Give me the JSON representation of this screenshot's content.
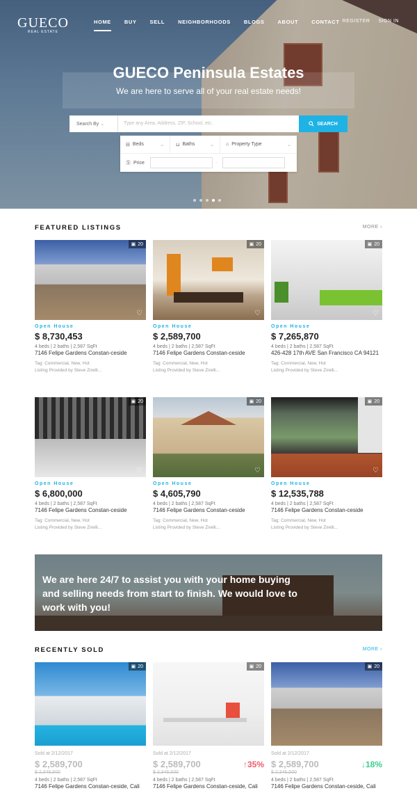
{
  "header": {
    "logo_title": "GUECO",
    "logo_sub": "REAL ESTATE",
    "nav": [
      "HOME",
      "BUY",
      "SELL",
      "NEIGHBORHOODS",
      "BLOGS",
      "ABOUT",
      "CONTACT"
    ],
    "register": "REGISTER",
    "signin": "SIGN IN"
  },
  "hero": {
    "title": "GUECO Peninsula Estates",
    "subtitle": "We are here to serve all of your real estate needs!"
  },
  "search": {
    "by": "Search By",
    "placeholder": "Type any Area, Address, ZIP, School, etc.",
    "button": "SEARCH"
  },
  "filters": {
    "beds": "Beds",
    "baths": "Baths",
    "type": "Property Type",
    "price": "Price"
  },
  "featured": {
    "title": "FEATURED LISTINGS",
    "more": "MORE",
    "photo_count": "20",
    "listings": [
      {
        "status": "Open House",
        "price": "$ 8,730,453",
        "meta": "4 beds  |  2 baths  |  2,587 SqFt",
        "address": "7146 Felipe Gardens Constan-ceside",
        "tags": "Tag: Commercial, New, Hot",
        "provider": "Listing Provided by Steve Zirelli..."
      },
      {
        "status": "Open House",
        "price": "$ 2,589,700",
        "meta": "4 beds  |  2 baths  |  2,587 SqFt",
        "address": "7146 Felipe Gardens Constan-ceside",
        "tags": "Tag: Commercial, New, Hot",
        "provider": "Listing Provided by Steve Zirelli..."
      },
      {
        "status": "Open House",
        "price": "$ 7,265,870",
        "meta": "4 beds  |  2 baths  |  2,587 SqFt",
        "address": "426-428 17th AVE San Francisco CA 94121",
        "tags": "Tag: Commercial, New, Hot",
        "provider": "Listing Provided by Steve Zirelli..."
      },
      {
        "status": "Open House",
        "price": "$ 6,800,000",
        "meta": "4 beds  |  2 baths  |  2,587 SqFt",
        "address": "7146 Felipe Gardens Constan-ceside",
        "tags": "Tag: Commercial, New, Hot",
        "provider": "Listing Provided by Steve Zirelli..."
      },
      {
        "status": "Open House",
        "price": "$ 4,605,790",
        "meta": "4 beds  |  2 baths  |  2,587 SqFt",
        "address": "7146 Felipe Gardens Constan-ceside",
        "tags": "Tag: Commercial, New, Hot",
        "provider": "Listing Provided by Steve Zirelli..."
      },
      {
        "status": "Open House",
        "price": "$ 12,535,788",
        "meta": "4 beds  |  2 baths  |  2,587 SqFt",
        "address": "7146 Felipe Gardens Constan-ceside",
        "tags": "Tag: Commercial, New, Hot",
        "provider": "Listing Provided by Steve Zirelli..."
      }
    ]
  },
  "banner": {
    "text": "We are here 24/7 to assist you with your home buying and selling needs from start to finish. We would love to work with you!"
  },
  "sold": {
    "title": "RECENTLY SOLD",
    "more": "MORE",
    "photo_count": "20",
    "items": [
      {
        "date": "Sold at 2/12/2017",
        "price": "$ 2,589,700",
        "old": "$ 2,345,500",
        "change": "",
        "meta": "4 beds  |  2 baths  |  2,587 SqFt",
        "address": "7146 Felipe Gardens Constan-ceside, Cali"
      },
      {
        "date": "Sold at 2/12/2017",
        "price": "$ 2,589,700",
        "old": "$ 2,345,500",
        "change": "↑35%",
        "meta": "4 beds  |  2 baths  |  2,587 SqFt",
        "address": "7146 Felipe Gardens Constan-ceside, Cali"
      },
      {
        "date": "Sold at 2/12/2017",
        "price": "$ 2,589,700",
        "old": "$ 2,345,500",
        "change": "↓18%",
        "meta": "4 beds  |  2 baths  |  2,587 SqFt",
        "address": "7146 Felipe Gardens Constan-ceside, Cali"
      }
    ]
  },
  "colors": {
    "accent": "#1eb2e5",
    "up": "#ef5d6a",
    "down": "#3fcf8e"
  }
}
